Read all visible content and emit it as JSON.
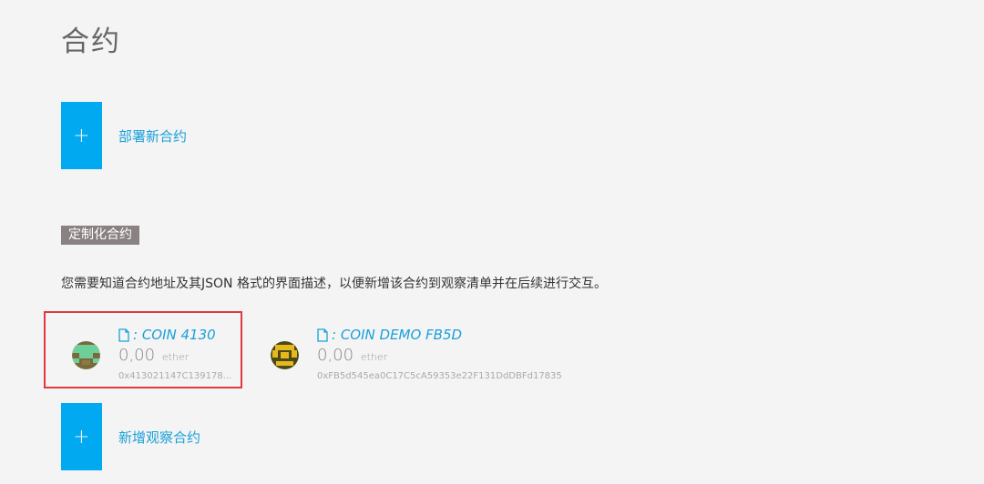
{
  "page": {
    "title": "合约"
  },
  "deploy": {
    "plus": "+",
    "label": "部署新合约"
  },
  "section": {
    "tag": "定制化合约"
  },
  "description": "您需要知道合约地址及其JSON 格式的界面描述，以便新增该合约到观察清单并在后续进行交互。",
  "tokens": [
    {
      "name": ": COIN 4130",
      "balance": "0,00",
      "unit": "ether",
      "address": "0x413021147C139178...",
      "icon": "identicon-green-icon"
    },
    {
      "name": ": COIN DEMO FB5D",
      "balance": "0,00",
      "unit": "ether",
      "address": "0xFB5d545ea0C17C5cA59353e22F131DdDBFd17835",
      "icon": "identicon-olive-icon"
    }
  ],
  "watch": {
    "plus": "+",
    "label": "新增观察合约"
  },
  "colors": {
    "accent": "#00a9f0",
    "link": "#1aa0d8",
    "highlight": "#e0393e",
    "tag_bg": "#8a8282"
  }
}
